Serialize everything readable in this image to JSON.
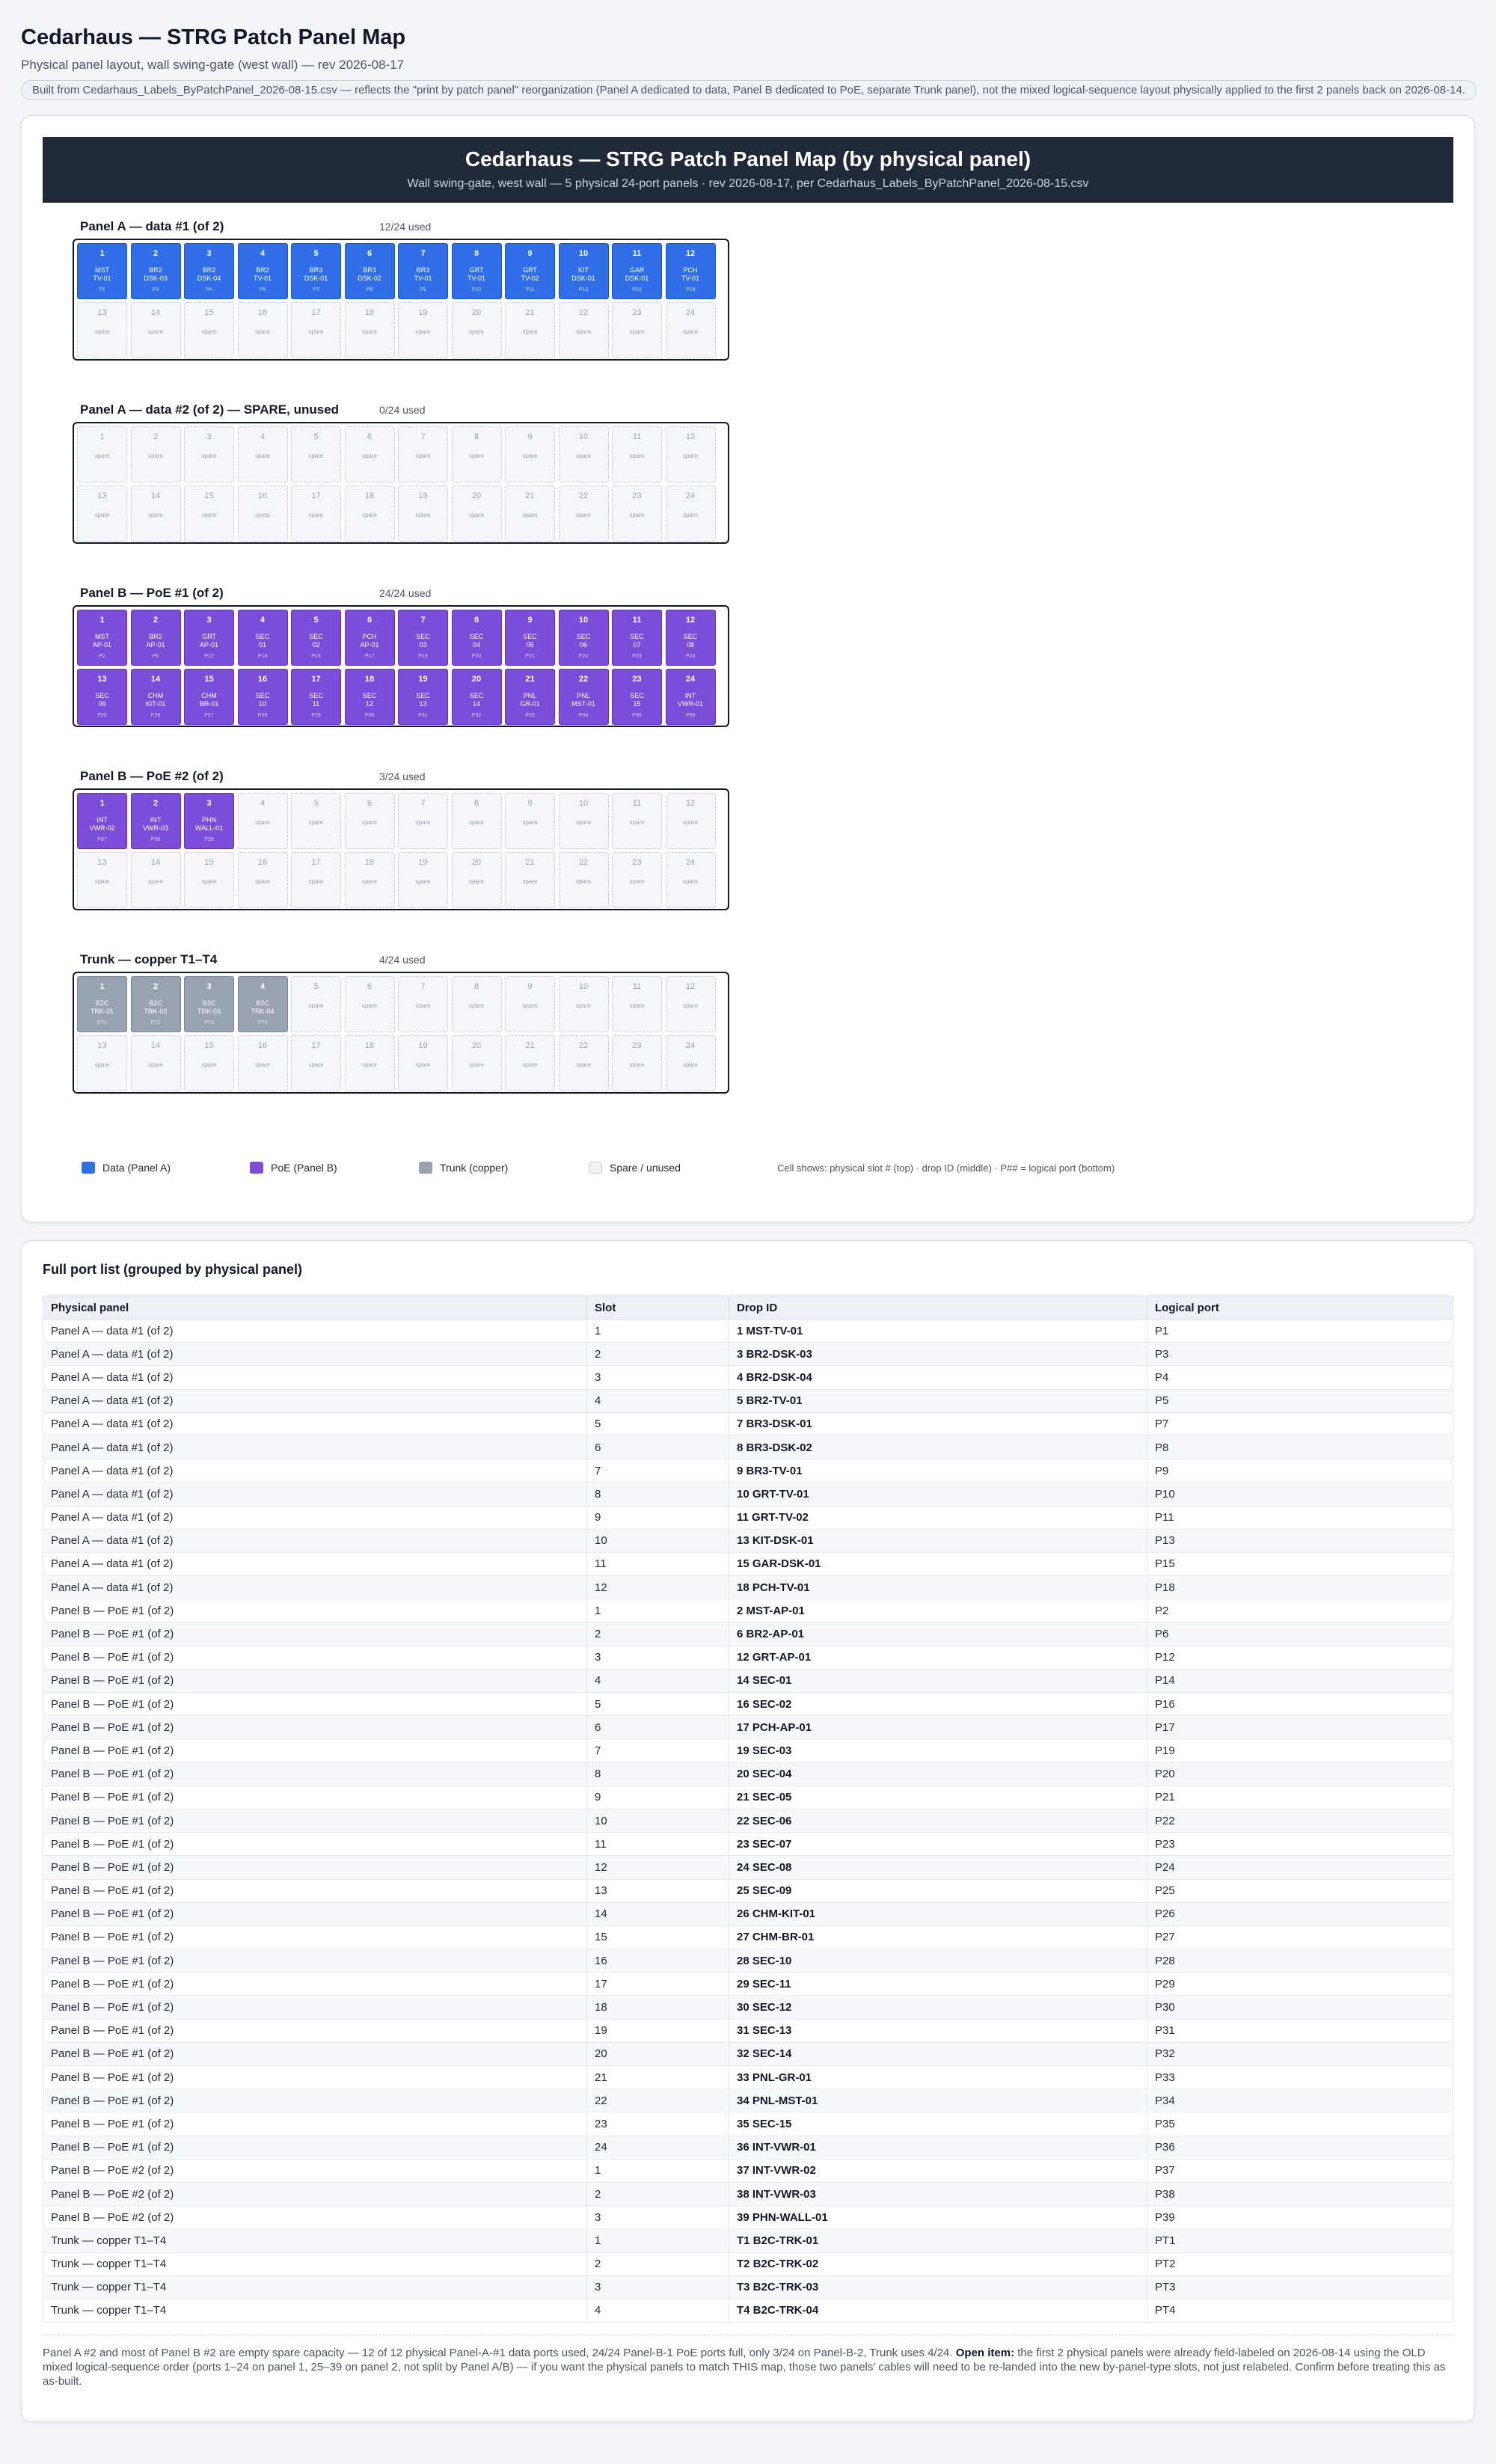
{
  "header": {
    "title": "Cedarhaus — STRG Patch Panel Map",
    "subtitle": "Physical panel layout, wall swing-gate (west wall) — rev 2026-08-17",
    "note": "Built from Cedarhaus_Labels_ByPatchPanel_2026-08-15.csv — reflects the \"print by patch panel\" reorganization (Panel A dedicated to data, Panel B dedicated to PoE, separate Trunk panel), not the mixed logical-sequence layout physically applied to the first 2 panels back on 2026-08-14."
  },
  "banner": {
    "title": "Cedarhaus — STRG Patch Panel Map (by physical panel)",
    "subtitle": "Wall swing-gate, west wall — 5 physical 24-port panels · rev 2026-08-17, per Cedarhaus_Labels_ByPatchPanel_2026-08-15.csv"
  },
  "colors": {
    "data": "#2f6ee6",
    "poe": "#7c4dd8",
    "trunk": "#98a2b3",
    "spare": "#f4f6fa",
    "banner": "#1f2937"
  },
  "spare_label": "spare",
  "panels": [
    {
      "name": "Panel A — data #1 (of 2)",
      "count": "12/24 used",
      "type": "data",
      "ports": [
        [
          "MST\nTV-01",
          "P1"
        ],
        [
          "BR2\nDSK-03",
          "P3"
        ],
        [
          "BR2\nDSK-04",
          "P4"
        ],
        [
          "BR2\nTV-01",
          "P5"
        ],
        [
          "BR3\nDSK-01",
          "P7"
        ],
        [
          "BR3\nDSK-02",
          "P8"
        ],
        [
          "BR3\nTV-01",
          "P9"
        ],
        [
          "GRT\nTV-01",
          "P10"
        ],
        [
          "GRT\nTV-02",
          "P11"
        ],
        [
          "KIT\nDSK-01",
          "P13"
        ],
        [
          "GAR\nDSK-01",
          "P15"
        ],
        [
          "PCH\nTV-01",
          "P18"
        ]
      ]
    },
    {
      "name": "Panel A — data #2 (of 2) — SPARE, unused",
      "count": "0/24 used",
      "type": "data",
      "ports": []
    },
    {
      "name": "Panel B — PoE #1 (of 2)",
      "count": "24/24 used",
      "type": "poe",
      "ports": [
        [
          "MST\nAP-01",
          "P2"
        ],
        [
          "BR2\nAP-01",
          "P6"
        ],
        [
          "GRT\nAP-01",
          "P12"
        ],
        [
          "SEC\n01",
          "P14"
        ],
        [
          "SEC\n02",
          "P16"
        ],
        [
          "PCH\nAP-01",
          "P17"
        ],
        [
          "SEC\n03",
          "P19"
        ],
        [
          "SEC\n04",
          "P20"
        ],
        [
          "SEC\n05",
          "P21"
        ],
        [
          "SEC\n06",
          "P22"
        ],
        [
          "SEC\n07",
          "P23"
        ],
        [
          "SEC\n08",
          "P24"
        ],
        [
          "SEC\n09",
          "P25"
        ],
        [
          "CHM\nKIT-01",
          "P26"
        ],
        [
          "CHM\nBR-01",
          "P27"
        ],
        [
          "SEC\n10",
          "P28"
        ],
        [
          "SEC\n11",
          "P29"
        ],
        [
          "SEC\n12",
          "P30"
        ],
        [
          "SEC\n13",
          "P31"
        ],
        [
          "SEC\n14",
          "P32"
        ],
        [
          "PNL\nGR-01",
          "P33"
        ],
        [
          "PNL\nMST-01",
          "P34"
        ],
        [
          "SEC\n15",
          "P35"
        ],
        [
          "INT\nVWR-01",
          "P36"
        ]
      ]
    },
    {
      "name": "Panel B — PoE #2 (of 2)",
      "count": "3/24 used",
      "type": "poe",
      "ports": [
        [
          "INT\nVWR-02",
          "P37"
        ],
        [
          "INT\nVWR-03",
          "P38"
        ],
        [
          "PHN\nWALL-01",
          "P39"
        ]
      ]
    },
    {
      "name": "Trunk — copper T1–T4",
      "count": "4/24 used",
      "type": "trunk",
      "ports": [
        [
          "B2C\nTRK-01",
          "PT1"
        ],
        [
          "B2C\nTRK-02",
          "PT2"
        ],
        [
          "B2C\nTRK-03",
          "PT3"
        ],
        [
          "B2C\nTRK-04",
          "PT4"
        ]
      ]
    }
  ],
  "legend": {
    "data": "Data (Panel A)",
    "poe": "PoE (Panel B)",
    "trunk": "Trunk (copper)",
    "spare": "Spare / unused",
    "note": "Cell shows: physical slot # (top) · drop ID (middle) · P## = logical port (bottom)"
  },
  "list": {
    "title": "Full port list (grouped by physical panel)",
    "columns": [
      "Physical panel",
      "Slot",
      "Drop ID",
      "Logical port"
    ],
    "rows": [
      [
        "Panel A — data #1 (of 2)",
        "1",
        "1 MST-TV-01",
        "P1"
      ],
      [
        "Panel A — data #1 (of 2)",
        "2",
        "3 BR2-DSK-03",
        "P3"
      ],
      [
        "Panel A — data #1 (of 2)",
        "3",
        "4 BR2-DSK-04",
        "P4"
      ],
      [
        "Panel A — data #1 (of 2)",
        "4",
        "5 BR2-TV-01",
        "P5"
      ],
      [
        "Panel A — data #1 (of 2)",
        "5",
        "7 BR3-DSK-01",
        "P7"
      ],
      [
        "Panel A — data #1 (of 2)",
        "6",
        "8 BR3-DSK-02",
        "P8"
      ],
      [
        "Panel A — data #1 (of 2)",
        "7",
        "9 BR3-TV-01",
        "P9"
      ],
      [
        "Panel A — data #1 (of 2)",
        "8",
        "10 GRT-TV-01",
        "P10"
      ],
      [
        "Panel A — data #1 (of 2)",
        "9",
        "11 GRT-TV-02",
        "P11"
      ],
      [
        "Panel A — data #1 (of 2)",
        "10",
        "13 KIT-DSK-01",
        "P13"
      ],
      [
        "Panel A — data #1 (of 2)",
        "11",
        "15 GAR-DSK-01",
        "P15"
      ],
      [
        "Panel A — data #1 (of 2)",
        "12",
        "18 PCH-TV-01",
        "P18"
      ],
      [
        "Panel B — PoE #1 (of 2)",
        "1",
        "2 MST-AP-01",
        "P2"
      ],
      [
        "Panel B — PoE #1 (of 2)",
        "2",
        "6 BR2-AP-01",
        "P6"
      ],
      [
        "Panel B — PoE #1 (of 2)",
        "3",
        "12 GRT-AP-01",
        "P12"
      ],
      [
        "Panel B — PoE #1 (of 2)",
        "4",
        "14 SEC-01",
        "P14"
      ],
      [
        "Panel B — PoE #1 (of 2)",
        "5",
        "16 SEC-02",
        "P16"
      ],
      [
        "Panel B — PoE #1 (of 2)",
        "6",
        "17 PCH-AP-01",
        "P17"
      ],
      [
        "Panel B — PoE #1 (of 2)",
        "7",
        "19 SEC-03",
        "P19"
      ],
      [
        "Panel B — PoE #1 (of 2)",
        "8",
        "20 SEC-04",
        "P20"
      ],
      [
        "Panel B — PoE #1 (of 2)",
        "9",
        "21 SEC-05",
        "P21"
      ],
      [
        "Panel B — PoE #1 (of 2)",
        "10",
        "22 SEC-06",
        "P22"
      ],
      [
        "Panel B — PoE #1 (of 2)",
        "11",
        "23 SEC-07",
        "P23"
      ],
      [
        "Panel B — PoE #1 (of 2)",
        "12",
        "24 SEC-08",
        "P24"
      ],
      [
        "Panel B — PoE #1 (of 2)",
        "13",
        "25 SEC-09",
        "P25"
      ],
      [
        "Panel B — PoE #1 (of 2)",
        "14",
        "26 CHM-KIT-01",
        "P26"
      ],
      [
        "Panel B — PoE #1 (of 2)",
        "15",
        "27 CHM-BR-01",
        "P27"
      ],
      [
        "Panel B — PoE #1 (of 2)",
        "16",
        "28 SEC-10",
        "P28"
      ],
      [
        "Panel B — PoE #1 (of 2)",
        "17",
        "29 SEC-11",
        "P29"
      ],
      [
        "Panel B — PoE #1 (of 2)",
        "18",
        "30 SEC-12",
        "P30"
      ],
      [
        "Panel B — PoE #1 (of 2)",
        "19",
        "31 SEC-13",
        "P31"
      ],
      [
        "Panel B — PoE #1 (of 2)",
        "20",
        "32 SEC-14",
        "P32"
      ],
      [
        "Panel B — PoE #1 (of 2)",
        "21",
        "33 PNL-GR-01",
        "P33"
      ],
      [
        "Panel B — PoE #1 (of 2)",
        "22",
        "34 PNL-MST-01",
        "P34"
      ],
      [
        "Panel B — PoE #1 (of 2)",
        "23",
        "35 SEC-15",
        "P35"
      ],
      [
        "Panel B — PoE #1 (of 2)",
        "24",
        "36 INT-VWR-01",
        "P36"
      ],
      [
        "Panel B — PoE #2 (of 2)",
        "1",
        "37 INT-VWR-02",
        "P37"
      ],
      [
        "Panel B — PoE #2 (of 2)",
        "2",
        "38 INT-VWR-03",
        "P38"
      ],
      [
        "Panel B — PoE #2 (of 2)",
        "3",
        "39 PHN-WALL-01",
        "P39"
      ],
      [
        "Trunk — copper T1–T4",
        "1",
        "T1 B2C-TRK-01",
        "PT1"
      ],
      [
        "Trunk — copper T1–T4",
        "2",
        "T2 B2C-TRK-02",
        "PT2"
      ],
      [
        "Trunk — copper T1–T4",
        "3",
        "T3 B2C-TRK-03",
        "PT3"
      ],
      [
        "Trunk — copper T1–T4",
        "4",
        "T4 B2C-TRK-04",
        "PT4"
      ]
    ]
  },
  "footnote": {
    "before": "Panel A #2 and most of Panel B #2 are empty spare capacity — 12 of 12 physical Panel-A-#1 data ports used, 24/24 Panel-B-1 PoE ports full, only 3/24 on Panel-B-2, Trunk uses 4/24. ",
    "bold": "Open item:",
    "after": " the first 2 physical panels were already field-labeled on 2026-08-14 using the OLD mixed logical-sequence order (ports 1–24 on panel 1, 25–39 on panel 2, not split by Panel A/B) — if you want the physical panels to match THIS map, those two panels' cables will need to be re-landed into the new by-panel-type slots, not just relabeled. Confirm before treating this as as-built."
  }
}
